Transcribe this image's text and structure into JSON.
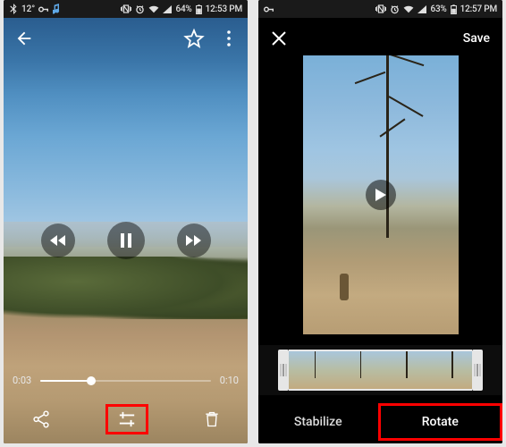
{
  "left": {
    "status": {
      "temp": "12°",
      "battery_pct": "64%",
      "time": "12:53 PM"
    },
    "playback": {
      "elapsed": "0:03",
      "duration": "0:10",
      "progress_pct": 30
    },
    "highlight": "edit-button"
  },
  "right": {
    "status": {
      "battery_pct": "63%",
      "time": "12:57 PM"
    },
    "topbar": {
      "save_label": "Save"
    },
    "tabs": {
      "stabilize_label": "Stabilize",
      "rotate_label": "Rotate"
    },
    "highlight": "rotate-tab",
    "filmstrip_frame_count": 4
  },
  "colors": {
    "highlight": "#ff0000"
  }
}
